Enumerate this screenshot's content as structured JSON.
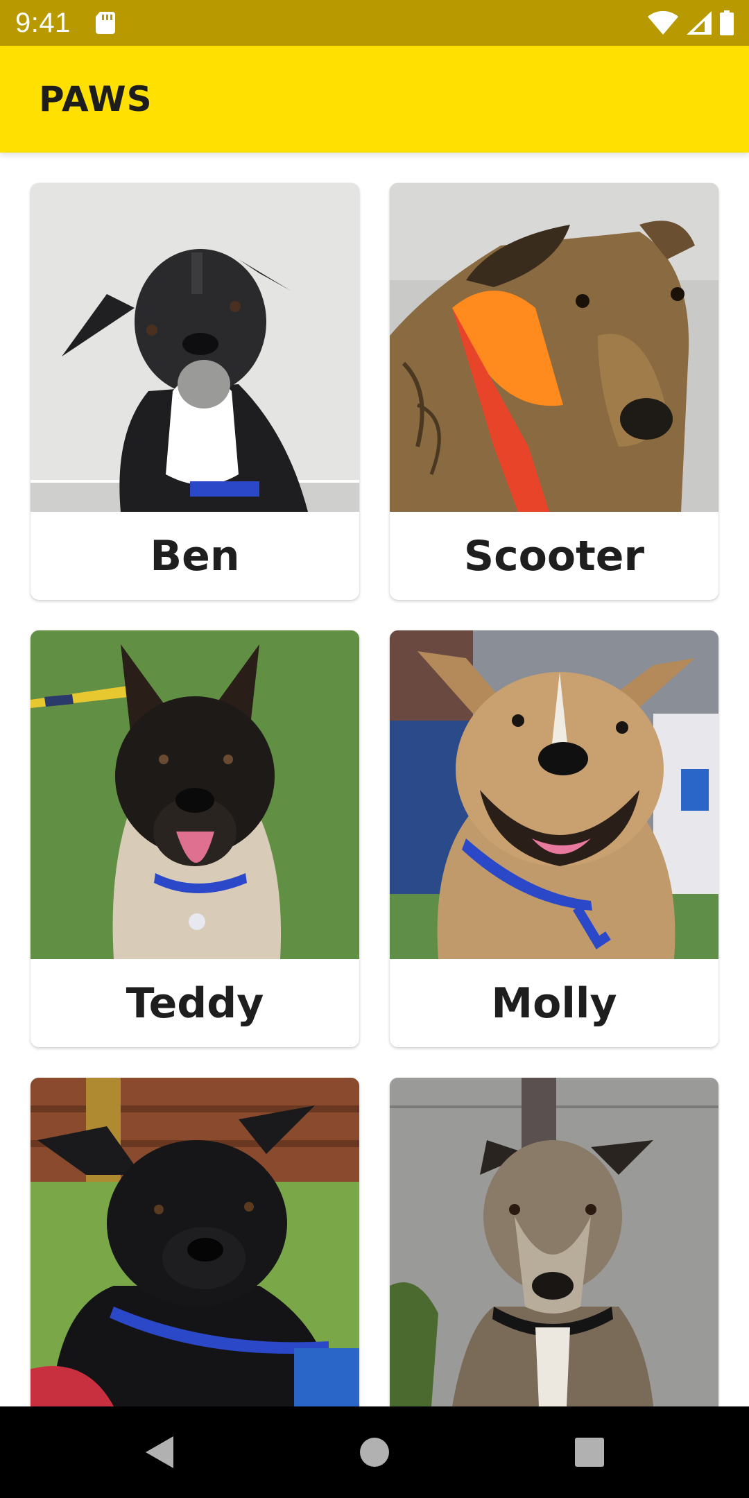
{
  "status_bar": {
    "time": "9:41",
    "icons": [
      "sd-card-icon",
      "wifi-icon",
      "signal-icon",
      "battery-icon"
    ]
  },
  "app_bar": {
    "title": "PAWS"
  },
  "dogs": [
    {
      "name": "Ben"
    },
    {
      "name": "Scooter"
    },
    {
      "name": "Teddy"
    },
    {
      "name": "Molly"
    },
    {
      "name": ""
    },
    {
      "name": ""
    }
  ],
  "nav_bar": {
    "icons": [
      "back-icon",
      "home-icon",
      "recents-icon"
    ]
  },
  "colors": {
    "status_bar": "#B89A00",
    "app_bar": "#FFE000",
    "text": "#1e1e1e",
    "nav_bar": "#000000"
  }
}
